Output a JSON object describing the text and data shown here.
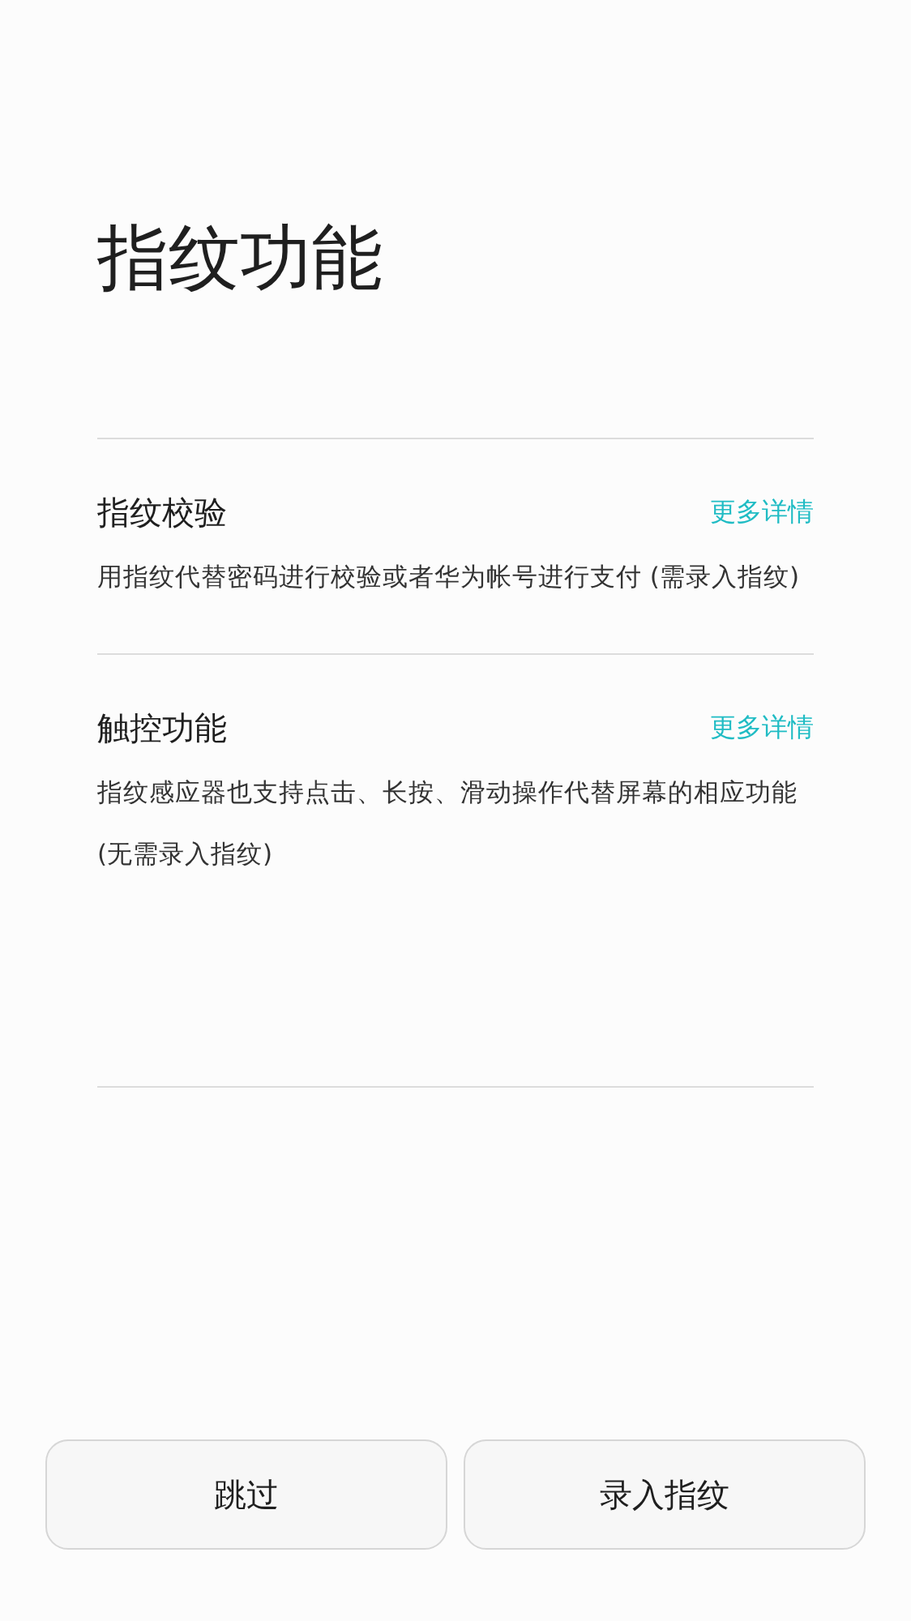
{
  "title": "指纹功能",
  "sections": [
    {
      "title": "指纹校验",
      "link": "更多详情",
      "description": "用指纹代替密码进行校验或者华为帐号进行支付 (需录入指纹)"
    },
    {
      "title": "触控功能",
      "link": "更多详情",
      "description": "指纹感应器也支持点击、长按、滑动操作代替屏幕的相应功能 (无需录入指纹)"
    }
  ],
  "buttons": [
    "跳过",
    "录入指纹"
  ]
}
